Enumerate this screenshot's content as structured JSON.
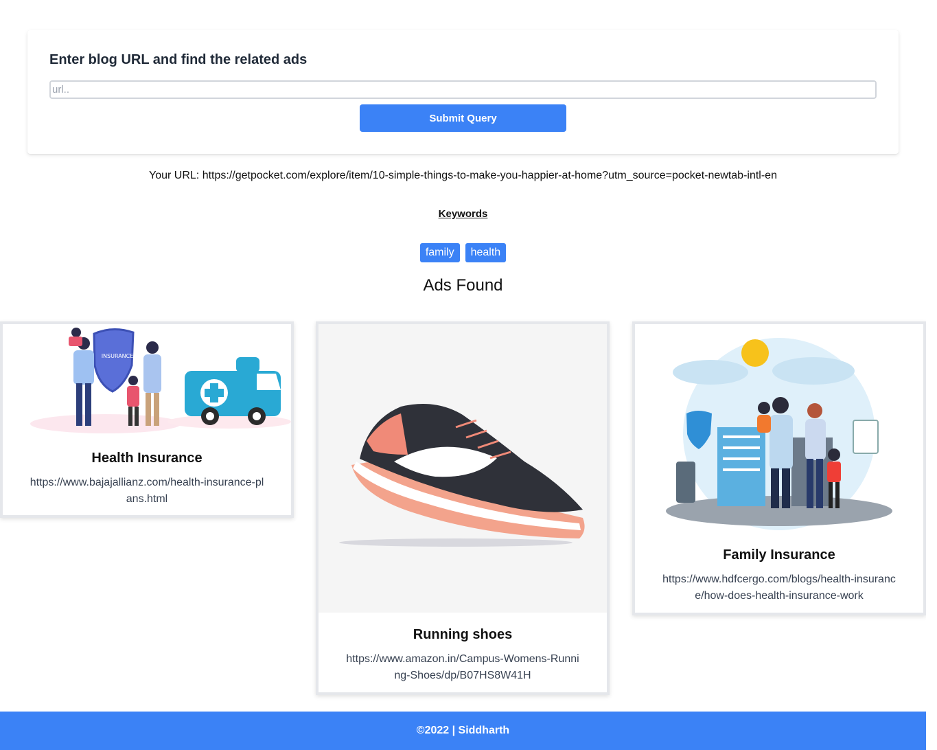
{
  "form": {
    "title": "Enter blog URL and find the related ads",
    "input_placeholder": "url..",
    "input_value": "",
    "submit_label": "Submit Query"
  },
  "result": {
    "your_url": "Your URL: https://getpocket.com/explore/item/10-simple-things-to-make-you-happier-at-home?utm_source=pocket-newtab-intl-en",
    "keywords_heading": "Keywords",
    "keywords": [
      "family",
      "health"
    ],
    "ads_heading": "Ads Found"
  },
  "ads": [
    {
      "title": "Health Insurance",
      "url": "https://www.bajajallianz.com/health-insurance-plans.html",
      "image": "health-insurance-illustration",
      "image_text": "INSURANCE"
    },
    {
      "title": "Running shoes",
      "url": "https://www.amazon.in/Campus-Womens-Running-Shoes/dp/B07HS8W41H",
      "image": "running-shoe-photo"
    },
    {
      "title": "Family Insurance",
      "url": "https://www.hdfcergo.com/blogs/health-insurance/how-does-health-insurance-work",
      "image": "family-insurance-illustration"
    }
  ],
  "footer": {
    "text": "©2022 | Siddharth"
  },
  "colors": {
    "accent": "#3b82f6"
  }
}
